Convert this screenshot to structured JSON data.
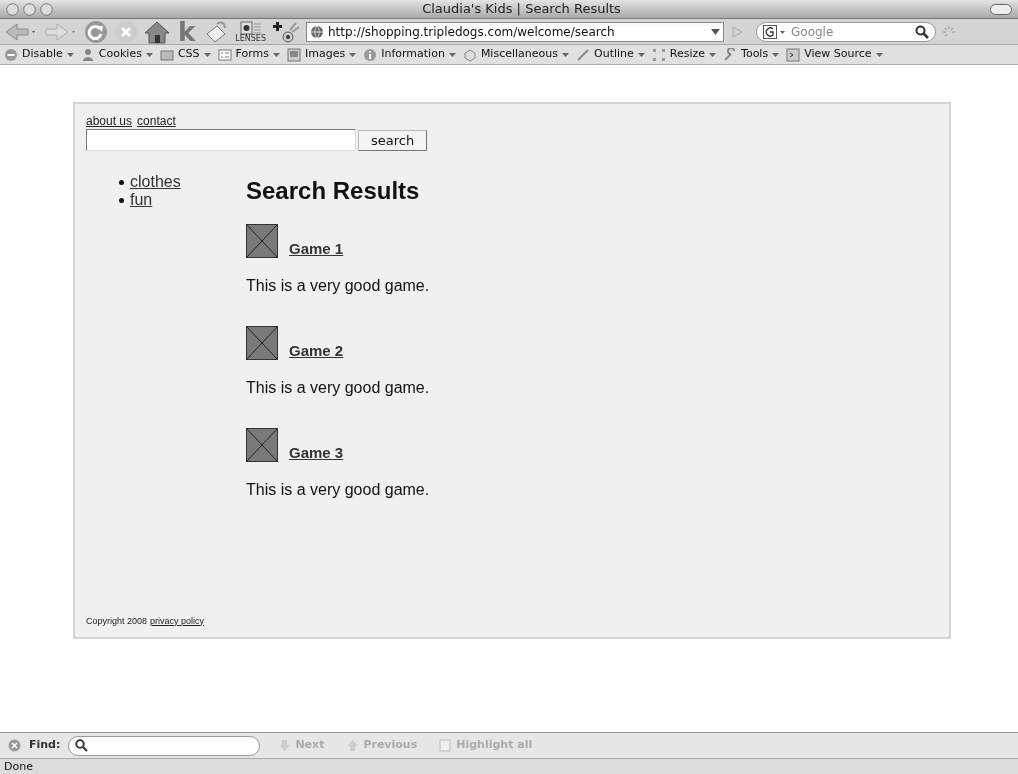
{
  "window": {
    "title": "Claudia's Kids | Search Results"
  },
  "toolbar": {
    "k_label": "k",
    "lenses_label": "LENSES",
    "address": "http://shopping.tripledogs.com/welcome/search",
    "search_placeholder": "Google",
    "forward_disabled": true
  },
  "dev_toolbar": [
    {
      "label": "Disable"
    },
    {
      "label": "Cookies"
    },
    {
      "label": "CSS"
    },
    {
      "label": "Forms"
    },
    {
      "label": "Images"
    },
    {
      "label": "Information"
    },
    {
      "label": "Miscellaneous"
    },
    {
      "label": "Outline"
    },
    {
      "label": "Resize"
    },
    {
      "label": "Tools"
    },
    {
      "label": "View Source"
    }
  ],
  "page": {
    "top_links": [
      "about us",
      "contact"
    ],
    "search_button": "search",
    "categories": [
      "clothes",
      "fun"
    ],
    "heading": "Search Results",
    "results": [
      {
        "title": "Game 1",
        "description": "This is a very good game."
      },
      {
        "title": "Game 2",
        "description": "This is a very good game."
      },
      {
        "title": "Game 3",
        "description": "This is a very good game."
      }
    ],
    "copyright": "Copyright 2008",
    "privacy_link": "privacy policy"
  },
  "find_bar": {
    "label": "Find:",
    "buttons": [
      {
        "label": "Next",
        "disabled": true
      },
      {
        "label": "Previous",
        "disabled": true
      },
      {
        "label": "Highlight all",
        "disabled": true
      }
    ]
  },
  "status_bar": "Done"
}
